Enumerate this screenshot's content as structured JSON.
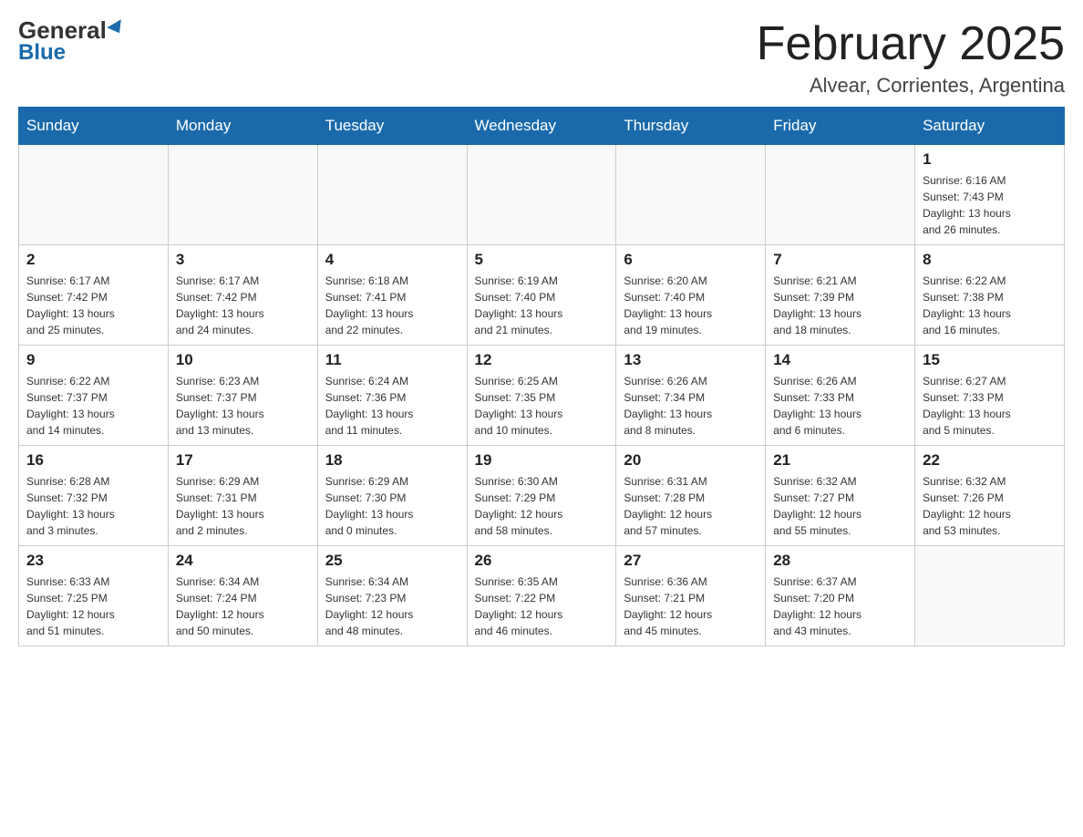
{
  "header": {
    "logo_general": "General",
    "logo_blue": "Blue",
    "month_title": "February 2025",
    "location": "Alvear, Corrientes, Argentina"
  },
  "days_of_week": [
    "Sunday",
    "Monday",
    "Tuesday",
    "Wednesday",
    "Thursday",
    "Friday",
    "Saturday"
  ],
  "weeks": [
    {
      "days": [
        {
          "date": "",
          "info": ""
        },
        {
          "date": "",
          "info": ""
        },
        {
          "date": "",
          "info": ""
        },
        {
          "date": "",
          "info": ""
        },
        {
          "date": "",
          "info": ""
        },
        {
          "date": "",
          "info": ""
        },
        {
          "date": "1",
          "info": "Sunrise: 6:16 AM\nSunset: 7:43 PM\nDaylight: 13 hours\nand 26 minutes."
        }
      ]
    },
    {
      "days": [
        {
          "date": "2",
          "info": "Sunrise: 6:17 AM\nSunset: 7:42 PM\nDaylight: 13 hours\nand 25 minutes."
        },
        {
          "date": "3",
          "info": "Sunrise: 6:17 AM\nSunset: 7:42 PM\nDaylight: 13 hours\nand 24 minutes."
        },
        {
          "date": "4",
          "info": "Sunrise: 6:18 AM\nSunset: 7:41 PM\nDaylight: 13 hours\nand 22 minutes."
        },
        {
          "date": "5",
          "info": "Sunrise: 6:19 AM\nSunset: 7:40 PM\nDaylight: 13 hours\nand 21 minutes."
        },
        {
          "date": "6",
          "info": "Sunrise: 6:20 AM\nSunset: 7:40 PM\nDaylight: 13 hours\nand 19 minutes."
        },
        {
          "date": "7",
          "info": "Sunrise: 6:21 AM\nSunset: 7:39 PM\nDaylight: 13 hours\nand 18 minutes."
        },
        {
          "date": "8",
          "info": "Sunrise: 6:22 AM\nSunset: 7:38 PM\nDaylight: 13 hours\nand 16 minutes."
        }
      ]
    },
    {
      "days": [
        {
          "date": "9",
          "info": "Sunrise: 6:22 AM\nSunset: 7:37 PM\nDaylight: 13 hours\nand 14 minutes."
        },
        {
          "date": "10",
          "info": "Sunrise: 6:23 AM\nSunset: 7:37 PM\nDaylight: 13 hours\nand 13 minutes."
        },
        {
          "date": "11",
          "info": "Sunrise: 6:24 AM\nSunset: 7:36 PM\nDaylight: 13 hours\nand 11 minutes."
        },
        {
          "date": "12",
          "info": "Sunrise: 6:25 AM\nSunset: 7:35 PM\nDaylight: 13 hours\nand 10 minutes."
        },
        {
          "date": "13",
          "info": "Sunrise: 6:26 AM\nSunset: 7:34 PM\nDaylight: 13 hours\nand 8 minutes."
        },
        {
          "date": "14",
          "info": "Sunrise: 6:26 AM\nSunset: 7:33 PM\nDaylight: 13 hours\nand 6 minutes."
        },
        {
          "date": "15",
          "info": "Sunrise: 6:27 AM\nSunset: 7:33 PM\nDaylight: 13 hours\nand 5 minutes."
        }
      ]
    },
    {
      "days": [
        {
          "date": "16",
          "info": "Sunrise: 6:28 AM\nSunset: 7:32 PM\nDaylight: 13 hours\nand 3 minutes."
        },
        {
          "date": "17",
          "info": "Sunrise: 6:29 AM\nSunset: 7:31 PM\nDaylight: 13 hours\nand 2 minutes."
        },
        {
          "date": "18",
          "info": "Sunrise: 6:29 AM\nSunset: 7:30 PM\nDaylight: 13 hours\nand 0 minutes."
        },
        {
          "date": "19",
          "info": "Sunrise: 6:30 AM\nSunset: 7:29 PM\nDaylight: 12 hours\nand 58 minutes."
        },
        {
          "date": "20",
          "info": "Sunrise: 6:31 AM\nSunset: 7:28 PM\nDaylight: 12 hours\nand 57 minutes."
        },
        {
          "date": "21",
          "info": "Sunrise: 6:32 AM\nSunset: 7:27 PM\nDaylight: 12 hours\nand 55 minutes."
        },
        {
          "date": "22",
          "info": "Sunrise: 6:32 AM\nSunset: 7:26 PM\nDaylight: 12 hours\nand 53 minutes."
        }
      ]
    },
    {
      "days": [
        {
          "date": "23",
          "info": "Sunrise: 6:33 AM\nSunset: 7:25 PM\nDaylight: 12 hours\nand 51 minutes."
        },
        {
          "date": "24",
          "info": "Sunrise: 6:34 AM\nSunset: 7:24 PM\nDaylight: 12 hours\nand 50 minutes."
        },
        {
          "date": "25",
          "info": "Sunrise: 6:34 AM\nSunset: 7:23 PM\nDaylight: 12 hours\nand 48 minutes."
        },
        {
          "date": "26",
          "info": "Sunrise: 6:35 AM\nSunset: 7:22 PM\nDaylight: 12 hours\nand 46 minutes."
        },
        {
          "date": "27",
          "info": "Sunrise: 6:36 AM\nSunset: 7:21 PM\nDaylight: 12 hours\nand 45 minutes."
        },
        {
          "date": "28",
          "info": "Sunrise: 6:37 AM\nSunset: 7:20 PM\nDaylight: 12 hours\nand 43 minutes."
        },
        {
          "date": "",
          "info": ""
        }
      ]
    }
  ]
}
